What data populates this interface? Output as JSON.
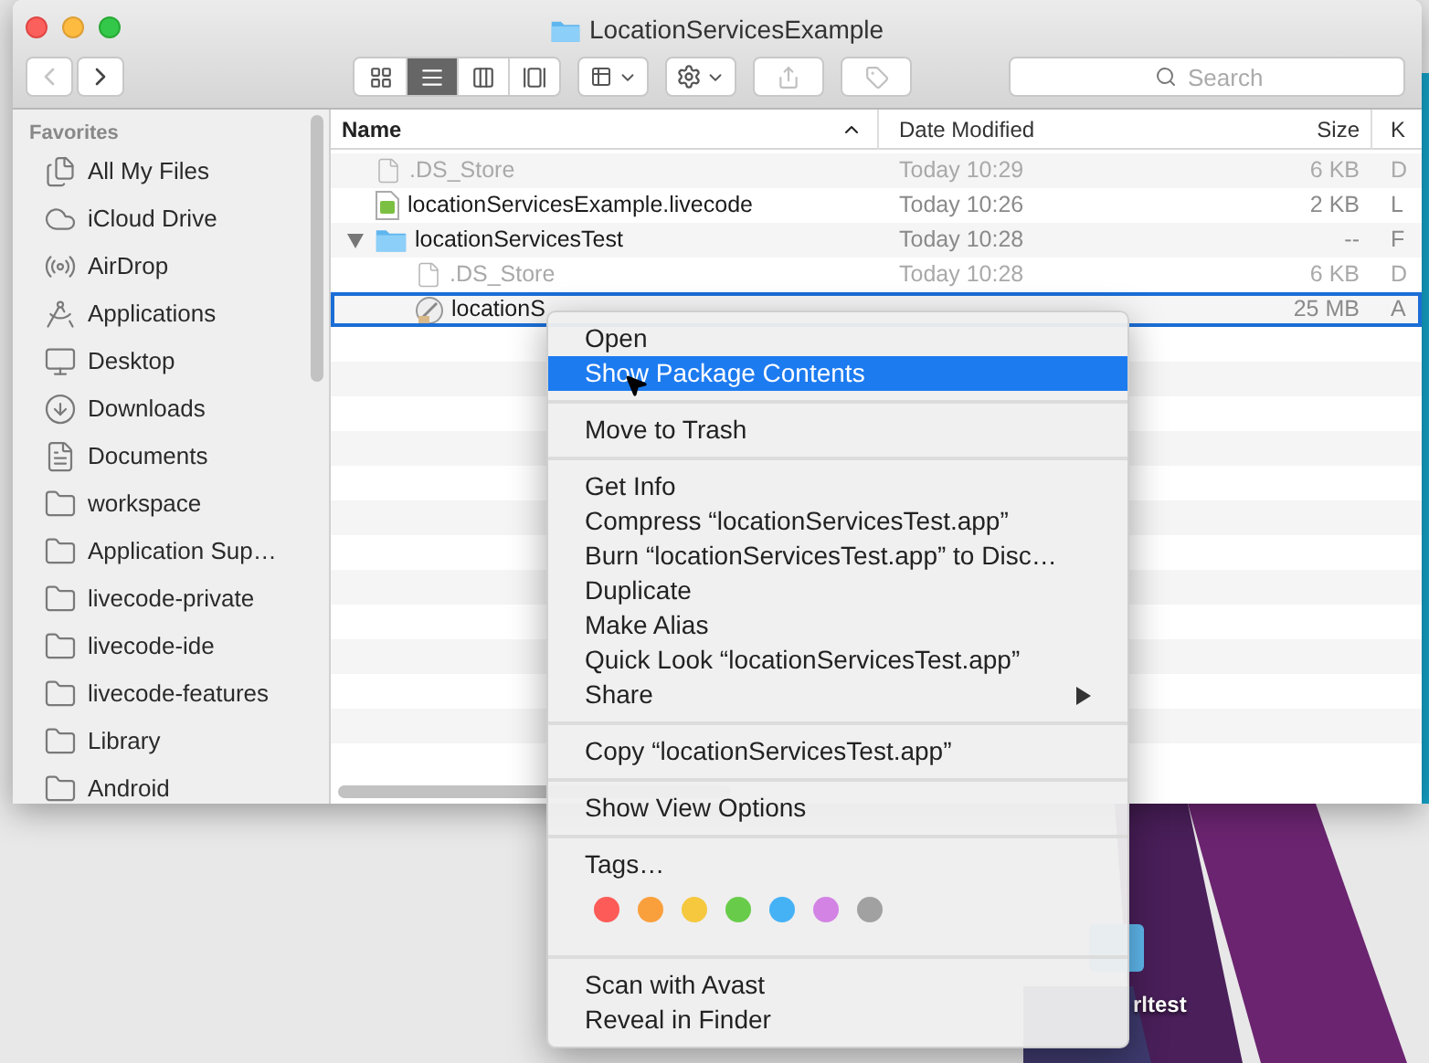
{
  "window": {
    "title": "LocationServicesExample"
  },
  "toolbar": {
    "back": {
      "disabled": true
    },
    "forward": {
      "disabled": false
    },
    "views": [
      {
        "kind": "icon",
        "selected": false
      },
      {
        "kind": "list",
        "selected": true
      },
      {
        "kind": "column",
        "selected": false
      },
      {
        "kind": "coverflow",
        "selected": false
      }
    ],
    "share": {
      "disabled": true
    },
    "tag": {
      "disabled": true
    },
    "search": {
      "placeholder": "Search"
    }
  },
  "sidebar": {
    "heading": "Favorites",
    "items": [
      {
        "label": "All My Files",
        "kind": "files"
      },
      {
        "label": "iCloud Drive",
        "kind": "cloud"
      },
      {
        "label": "AirDrop",
        "kind": "airdrop"
      },
      {
        "label": "Applications",
        "kind": "applications"
      },
      {
        "label": "Desktop",
        "kind": "desktop"
      },
      {
        "label": "Downloads",
        "kind": "downloads"
      },
      {
        "label": "Documents",
        "kind": "documents"
      },
      {
        "label": "workspace",
        "kind": "folder"
      },
      {
        "label": "Application Sup…",
        "kind": "folder"
      },
      {
        "label": "livecode-private",
        "kind": "folder"
      },
      {
        "label": "livecode-ide",
        "kind": "folder"
      },
      {
        "label": "livecode-features",
        "kind": "folder"
      },
      {
        "label": "Library",
        "kind": "folder"
      },
      {
        "label": "Android",
        "kind": "folder"
      }
    ]
  },
  "table": {
    "columns": [
      {
        "label": "Name",
        "sorted": true
      },
      {
        "label": "Date Modified",
        "sorted": false
      },
      {
        "label": "Size",
        "sorted": false
      },
      {
        "label": "K",
        "sorted": false
      }
    ],
    "rows": [
      {
        "name": ".DS_Store",
        "date": "Today 10:29",
        "size": "6 KB",
        "column_4": "D",
        "kind": "document",
        "dimmed": true,
        "selected": false
      },
      {
        "name": "locationServicesExample.livecode",
        "date": "Today 10:26",
        "size": "2 KB",
        "column_4": "L",
        "kind": "livecode",
        "dimmed": false,
        "selected": false
      },
      {
        "name": "locationServicesTest",
        "date": "Today 10:28",
        "size": "--",
        "column_4": "F",
        "kind": "folder",
        "dimmed": false,
        "selected": false,
        "expanded": true,
        "children": [
          {
            "name": ".DS_Store",
            "date": "Today 10:28",
            "size": "6 KB",
            "column_4": "D",
            "kind": "document",
            "dimmed": true,
            "selected": false
          },
          {
            "name": "locationS",
            "size": "25 MB",
            "column_4": "A",
            "kind": "app",
            "dimmed": false,
            "selected": true
          }
        ]
      }
    ]
  },
  "context_menu": {
    "groups": [
      {
        "kind": "items",
        "items": [
          {
            "label": "Open",
            "selected": false,
            "submenu": false
          },
          {
            "label": "Show Package Contents",
            "selected": true,
            "submenu": false
          }
        ]
      },
      {
        "kind": "items",
        "items": [
          {
            "label": "Move to Trash",
            "selected": false,
            "submenu": false
          }
        ]
      },
      {
        "kind": "items",
        "items": [
          {
            "label": "Get Info",
            "selected": false,
            "submenu": false
          },
          {
            "label": "Compress “locationServicesTest.app”",
            "selected": false,
            "submenu": false
          },
          {
            "label": "Burn “locationServicesTest.app” to Disc…",
            "selected": false,
            "submenu": false
          },
          {
            "label": "Duplicate",
            "selected": false,
            "submenu": false
          },
          {
            "label": "Make Alias",
            "selected": false,
            "submenu": false
          },
          {
            "label": "Quick Look “locationServicesTest.app”",
            "selected": false,
            "submenu": false
          },
          {
            "label": "Share",
            "selected": false,
            "submenu": true
          }
        ]
      },
      {
        "kind": "items",
        "items": [
          {
            "label": "Copy “locationServicesTest.app”",
            "selected": false,
            "submenu": false
          }
        ]
      },
      {
        "kind": "items",
        "items": [
          {
            "label": "Show View Options",
            "selected": false,
            "submenu": false
          }
        ]
      },
      {
        "kind": "tags",
        "label": "Tags…",
        "tags": [
          {
            "color": "#fc5b57"
          },
          {
            "color": "#f9a03c"
          },
          {
            "color": "#f5c83e"
          },
          {
            "color": "#68cc4a"
          },
          {
            "color": "#45b2f6"
          },
          {
            "color": "#d283e3"
          },
          {
            "color": "#a1a1a1"
          }
        ]
      },
      {
        "kind": "items",
        "items": [
          {
            "label": "Scan with Avast",
            "selected": false,
            "submenu": false
          },
          {
            "label": "Reveal in Finder",
            "selected": false,
            "submenu": false
          }
        ]
      }
    ]
  },
  "desktop": {
    "icon_label": "rltest"
  }
}
